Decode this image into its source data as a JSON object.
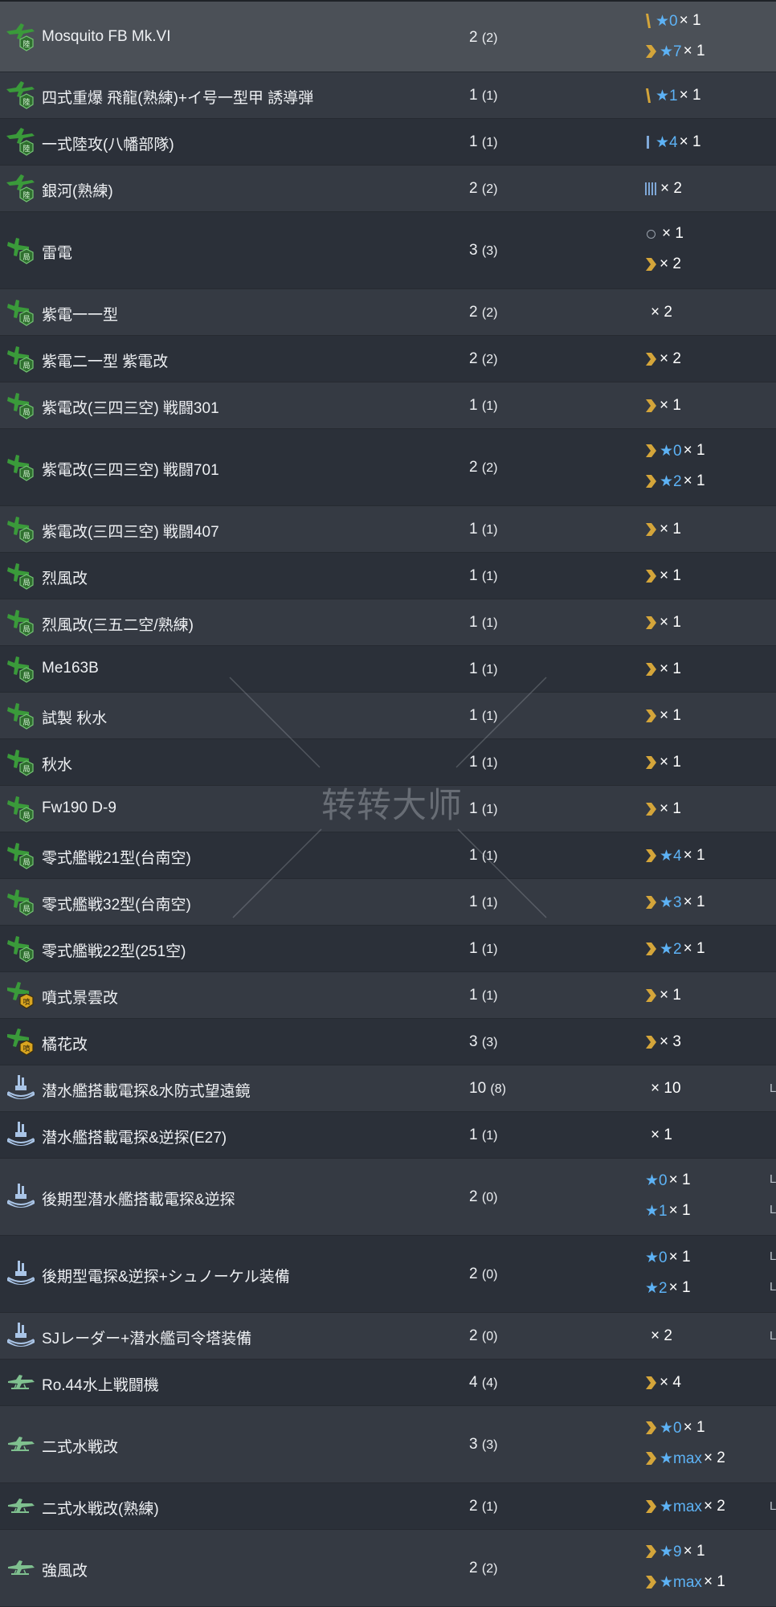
{
  "colors": {
    "row_odd": "#353a43",
    "row_even": "#2b3039",
    "row_selected": "#4b5057",
    "star_blue": "#5db2f5",
    "chevron_gold": "#d4a53a",
    "plane_green": "#3a9a3a",
    "badge_green": "#2f6f2f",
    "badge_gold": "#d9a520",
    "seaplane_green": "#7fc08f",
    "submarine_blue": "#a9c4e6"
  },
  "watermark": "转转大师",
  "rows": [
    {
      "icon": "land-attacker-icon",
      "name": "Mosquito FB Mk.VI",
      "count": "2",
      "sub": "(2)",
      "selected": true,
      "prof": [
        {
          "mark": "bar1",
          "star": "★0",
          "times": "× 1"
        },
        {
          "mark": "chevron",
          "star": "★7",
          "times": "× 1"
        }
      ]
    },
    {
      "icon": "land-attacker-icon",
      "name": "四式重爆 飛龍(熟練)+イ号一型甲 誘導弾",
      "count": "1",
      "sub": "(1)",
      "prof": [
        {
          "mark": "bar1",
          "star": "★1",
          "times": "× 1"
        }
      ]
    },
    {
      "icon": "land-attacker-icon",
      "name": "一式陸攻(八幡部隊)",
      "count": "1",
      "sub": "(1)",
      "prof": [
        {
          "mark": "bar2",
          "star": "★4",
          "times": "× 1"
        }
      ]
    },
    {
      "icon": "land-attacker-icon",
      "name": "銀河(熟練)",
      "count": "2",
      "sub": "(2)",
      "prof": [
        {
          "mark": "bar4",
          "times": "× 2"
        }
      ]
    },
    {
      "icon": "interceptor-icon",
      "name": "雷電",
      "count": "3",
      "sub": "(3)",
      "prof": [
        {
          "mark": "ring",
          "times": "× 1"
        },
        {
          "mark": "chevron",
          "times": "× 2"
        }
      ]
    },
    {
      "icon": "interceptor-icon",
      "name": "紫電一一型",
      "count": "2",
      "sub": "(2)",
      "prof": [
        {
          "mark": "none",
          "times": "× 2"
        }
      ]
    },
    {
      "icon": "interceptor-icon",
      "name": "紫電二一型 紫電改",
      "count": "2",
      "sub": "(2)",
      "prof": [
        {
          "mark": "chevron",
          "times": "× 2"
        }
      ]
    },
    {
      "icon": "interceptor-icon",
      "name": "紫電改(三四三空) 戦闘301",
      "count": "1",
      "sub": "(1)",
      "prof": [
        {
          "mark": "chevron",
          "times": "× 1"
        }
      ]
    },
    {
      "icon": "interceptor-icon",
      "name": "紫電改(三四三空) 戦闘701",
      "count": "2",
      "sub": "(2)",
      "prof": [
        {
          "mark": "chevron",
          "star": "★0",
          "times": "× 1"
        },
        {
          "mark": "chevron",
          "star": "★2",
          "times": "× 1"
        }
      ]
    },
    {
      "icon": "interceptor-icon",
      "name": "紫電改(三四三空) 戦闘407",
      "count": "1",
      "sub": "(1)",
      "prof": [
        {
          "mark": "chevron",
          "times": "× 1"
        }
      ]
    },
    {
      "icon": "interceptor-icon",
      "name": "烈風改",
      "count": "1",
      "sub": "(1)",
      "prof": [
        {
          "mark": "chevron",
          "times": "× 1"
        }
      ]
    },
    {
      "icon": "interceptor-icon",
      "name": "烈風改(三五二空/熟練)",
      "count": "1",
      "sub": "(1)",
      "prof": [
        {
          "mark": "chevron",
          "times": "× 1"
        }
      ]
    },
    {
      "icon": "interceptor-icon",
      "name": "Me163B",
      "count": "1",
      "sub": "(1)",
      "prof": [
        {
          "mark": "chevron",
          "times": "× 1"
        }
      ]
    },
    {
      "icon": "interceptor-icon",
      "name": "試製 秋水",
      "count": "1",
      "sub": "(1)",
      "prof": [
        {
          "mark": "chevron",
          "times": "× 1"
        }
      ]
    },
    {
      "icon": "interceptor-icon",
      "name": "秋水",
      "count": "1",
      "sub": "(1)",
      "prof": [
        {
          "mark": "chevron",
          "times": "× 1"
        }
      ]
    },
    {
      "icon": "interceptor-icon",
      "name": "Fw190 D-9",
      "count": "1",
      "sub": "(1)",
      "prof": [
        {
          "mark": "chevron",
          "times": "× 1"
        }
      ]
    },
    {
      "icon": "interceptor-icon",
      "name": "零式艦戦21型(台南空)",
      "count": "1",
      "sub": "(1)",
      "prof": [
        {
          "mark": "chevron",
          "star": "★4",
          "times": "× 1"
        }
      ]
    },
    {
      "icon": "interceptor-icon",
      "name": "零式艦戦32型(台南空)",
      "count": "1",
      "sub": "(1)",
      "prof": [
        {
          "mark": "chevron",
          "star": "★3",
          "times": "× 1"
        }
      ]
    },
    {
      "icon": "interceptor-icon",
      "name": "零式艦戦22型(251空)",
      "count": "1",
      "sub": "(1)",
      "prof": [
        {
          "mark": "chevron",
          "star": "★2",
          "times": "× 1"
        }
      ]
    },
    {
      "icon": "jet-icon",
      "name": "噴式景雲改",
      "count": "1",
      "sub": "(1)",
      "prof": [
        {
          "mark": "chevron",
          "times": "× 1"
        }
      ]
    },
    {
      "icon": "jet-icon",
      "name": "橘花改",
      "count": "3",
      "sub": "(3)",
      "prof": [
        {
          "mark": "chevron",
          "times": "× 3"
        }
      ]
    },
    {
      "icon": "submarine-equipment-icon",
      "name": "潜水艦搭載電探&水防式望遠鏡",
      "count": "10",
      "sub": "(8)",
      "edge": [
        "L"
      ],
      "prof": [
        {
          "mark": "none",
          "times": "× 10"
        }
      ]
    },
    {
      "icon": "submarine-equipment-icon",
      "name": "潜水艦搭載電探&逆探(E27)",
      "count": "1",
      "sub": "(1)",
      "prof": [
        {
          "mark": "none",
          "times": "× 1"
        }
      ]
    },
    {
      "icon": "submarine-equipment-icon",
      "name": "後期型潜水艦搭載電探&逆探",
      "count": "2",
      "sub": "(0)",
      "edge": [
        "L",
        "L"
      ],
      "prof": [
        {
          "mark": "blank",
          "star": "★0",
          "times": "× 1"
        },
        {
          "mark": "blank",
          "star": "★1",
          "times": "× 1"
        }
      ]
    },
    {
      "icon": "submarine-equipment-icon",
      "name": "後期型電探&逆探+シュノーケル装備",
      "count": "2",
      "sub": "(0)",
      "edge": [
        "L",
        "L"
      ],
      "prof": [
        {
          "mark": "blank",
          "star": "★0",
          "times": "× 1"
        },
        {
          "mark": "blank",
          "star": "★2",
          "times": "× 1"
        }
      ]
    },
    {
      "icon": "submarine-equipment-icon",
      "name": "SJレーダー+潜水艦司令塔装備",
      "count": "2",
      "sub": "(0)",
      "edge": [
        "L"
      ],
      "prof": [
        {
          "mark": "none",
          "times": "× 2"
        }
      ]
    },
    {
      "icon": "seaplane-fighter-icon",
      "name": "Ro.44水上戦闘機",
      "count": "4",
      "sub": "(4)",
      "prof": [
        {
          "mark": "chevron",
          "times": "× 4"
        }
      ]
    },
    {
      "icon": "seaplane-fighter-icon",
      "name": "二式水戦改",
      "count": "3",
      "sub": "(3)",
      "prof": [
        {
          "mark": "chevron",
          "star": "★0",
          "times": "× 1"
        },
        {
          "mark": "chevron",
          "star": "★max",
          "times": "× 2"
        }
      ]
    },
    {
      "icon": "seaplane-fighter-icon",
      "name": "二式水戦改(熟練)",
      "count": "2",
      "sub": "(1)",
      "edge": [
        "L"
      ],
      "prof": [
        {
          "mark": "chevron",
          "star": "★max",
          "times": "× 2"
        }
      ]
    },
    {
      "icon": "seaplane-fighter-icon",
      "name": "強風改",
      "count": "2",
      "sub": "(2)",
      "prof": [
        {
          "mark": "chevron",
          "star": "★9",
          "times": "× 1"
        },
        {
          "mark": "chevron",
          "star": "★max",
          "times": "× 1"
        }
      ]
    }
  ]
}
